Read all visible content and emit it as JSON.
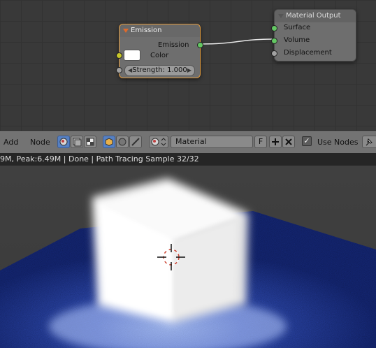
{
  "node_editor": {
    "emission_node": {
      "title": "Emission",
      "output_label": "Emission",
      "color_label": "Color",
      "strength_label": "Strength: 1.000"
    },
    "output_node": {
      "title": "Material Output",
      "inputs": [
        "Surface",
        "Volume",
        "Displacement"
      ]
    }
  },
  "header": {
    "menus": [
      "Add",
      "Node"
    ],
    "material_name": "Material",
    "fake_user": "F",
    "use_nodes_label": "Use Nodes"
  },
  "status": {
    "text": "9M, Peak:6.49M | Done | Path Tracing Sample 32/32"
  },
  "colors": {
    "node_highlight": "#e39a3b",
    "socket_shader": "#63c763",
    "socket_color": "#c7c729",
    "active_button": "#5680c2",
    "floor_blue": "#1f3fb5"
  }
}
